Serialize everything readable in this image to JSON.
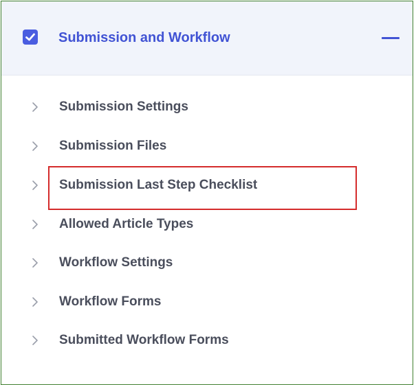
{
  "section": {
    "title": "Submission and Workflow",
    "checked": true,
    "expanded": true,
    "accent_color": "#4153d4",
    "border_color": "#3f7f2e"
  },
  "menu": {
    "items": [
      {
        "label": "Submission Settings"
      },
      {
        "label": "Submission Files"
      },
      {
        "label": "Submission Last Step Checklist",
        "highlighted": true,
        "highlight_color": "#d42a2a"
      },
      {
        "label": "Allowed Article Types"
      },
      {
        "label": "Workflow Settings"
      },
      {
        "label": "Workflow Forms"
      },
      {
        "label": "Submitted Workflow Forms"
      }
    ]
  },
  "icons": {
    "checkbox": "checkbox-checked-icon",
    "collapse": "minus-icon",
    "item_indicator": "chevron-right-icon"
  }
}
